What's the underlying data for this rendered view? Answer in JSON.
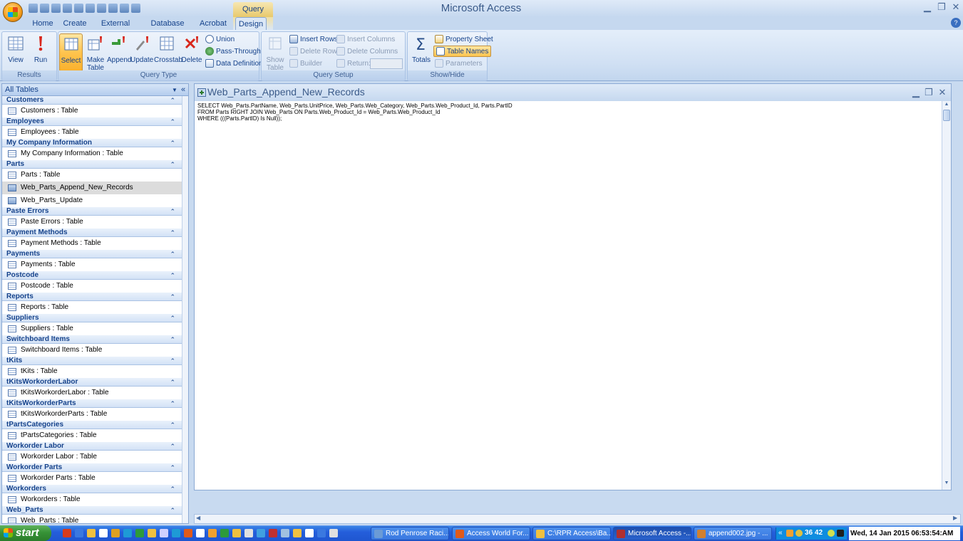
{
  "window": {
    "app_title": "Microsoft Access",
    "context_tab": "Query Tools"
  },
  "tabs": [
    "Home",
    "Create",
    "External Data",
    "Database Tools",
    "Acrobat",
    "Design"
  ],
  "ribbon": {
    "results": {
      "label": "Results",
      "view": "View",
      "run": "Run"
    },
    "query_type": {
      "label": "Query Type",
      "select": "Select",
      "make_table": "Make Table",
      "append": "Append",
      "update": "Update",
      "crosstab": "Crosstab",
      "delete": "Delete",
      "union": "Union",
      "pass_through": "Pass-Through",
      "data_definition": "Data Definition"
    },
    "query_setup": {
      "label": "Query Setup",
      "show_table": "Show Table",
      "insert_rows": "Insert Rows",
      "delete_rows": "Delete Rows",
      "builder": "Builder",
      "insert_columns": "Insert Columns",
      "delete_columns": "Delete Columns",
      "return": "Return:"
    },
    "show_hide": {
      "label": "Show/Hide",
      "totals": "Totals",
      "property_sheet": "Property Sheet",
      "table_names": "Table Names",
      "parameters": "Parameters"
    }
  },
  "nav": {
    "header": "All Tables",
    "groups": [
      {
        "name": "Customers",
        "items": [
          {
            "label": "Customers : Table",
            "kind": "table"
          }
        ]
      },
      {
        "name": "Employees",
        "items": [
          {
            "label": "Employees : Table",
            "kind": "table"
          }
        ]
      },
      {
        "name": "My Company Information",
        "items": [
          {
            "label": "My Company Information : Table",
            "kind": "table"
          }
        ]
      },
      {
        "name": "Parts",
        "items": [
          {
            "label": "Parts : Table",
            "kind": "table"
          },
          {
            "label": "Web_Parts_Append_New_Records",
            "kind": "query",
            "selected": true
          },
          {
            "label": "Web_Parts_Update",
            "kind": "query"
          }
        ]
      },
      {
        "name": "Paste Errors",
        "items": [
          {
            "label": "Paste Errors : Table",
            "kind": "table"
          }
        ]
      },
      {
        "name": "Payment Methods",
        "items": [
          {
            "label": "Payment Methods : Table",
            "kind": "table"
          }
        ]
      },
      {
        "name": "Payments",
        "items": [
          {
            "label": "Payments : Table",
            "kind": "table"
          }
        ]
      },
      {
        "name": "Postcode",
        "items": [
          {
            "label": "Postcode : Table",
            "kind": "table"
          }
        ]
      },
      {
        "name": "Reports",
        "items": [
          {
            "label": "Reports : Table",
            "kind": "table"
          }
        ]
      },
      {
        "name": "Suppliers",
        "items": [
          {
            "label": "Suppliers : Table",
            "kind": "table"
          }
        ]
      },
      {
        "name": "Switchboard Items",
        "items": [
          {
            "label": "Switchboard Items : Table",
            "kind": "table"
          }
        ]
      },
      {
        "name": "tKits",
        "items": [
          {
            "label": "tKits : Table",
            "kind": "table"
          }
        ]
      },
      {
        "name": "tKitsWorkorderLabor",
        "items": [
          {
            "label": "tKitsWorkorderLabor : Table",
            "kind": "table"
          }
        ]
      },
      {
        "name": "tKitsWorkorderParts",
        "items": [
          {
            "label": "tKitsWorkorderParts : Table",
            "kind": "table"
          }
        ]
      },
      {
        "name": "tPartsCategories",
        "items": [
          {
            "label": "tPartsCategories : Table",
            "kind": "table"
          }
        ]
      },
      {
        "name": "Workorder Labor",
        "items": [
          {
            "label": "Workorder Labor : Table",
            "kind": "table"
          }
        ]
      },
      {
        "name": "Workorder Parts",
        "items": [
          {
            "label": "Workorder Parts : Table",
            "kind": "table"
          }
        ]
      },
      {
        "name": "Workorders",
        "items": [
          {
            "label": "Workorders : Table",
            "kind": "table"
          }
        ]
      },
      {
        "name": "Web_Parts",
        "items": [
          {
            "label": "Web_Parts : Table",
            "kind": "table"
          }
        ]
      }
    ]
  },
  "document": {
    "title": "Web_Parts_Append_New_Records",
    "sql": "SELECT Web_Parts.PartName, Web_Parts.UnitPrice, Web_Parts.Web_Category, Web_Parts.Web_Product_Id, Parts.PartID\nFROM Parts RIGHT JOIN Web_Parts ON Parts.Web_Product_Id = Web_Parts.Web_Product_Id\nWHERE (((Parts.PartID) Is Null));"
  },
  "taskbar": {
    "start": "start",
    "tasks": [
      {
        "label": "Rod Penrose Raci...",
        "color": "#6b9bd6"
      },
      {
        "label": "Access World For...",
        "color": "#e05a1a"
      },
      {
        "label": "C:\\RPR Access\\Ba...",
        "color": "#f0c040"
      },
      {
        "label": "Microsoft Access -...",
        "color": "#b03030",
        "active": true
      },
      {
        "label": "append002.jpg - ...",
        "color": "#d08030"
      }
    ],
    "tray_text": "36 42",
    "clock": "Wed, 14 Jan 2015   06:53:54:AM"
  },
  "colors": {
    "accent": "#15428b",
    "selected_button": "#ffc44e",
    "taskbar": "#245edb"
  }
}
